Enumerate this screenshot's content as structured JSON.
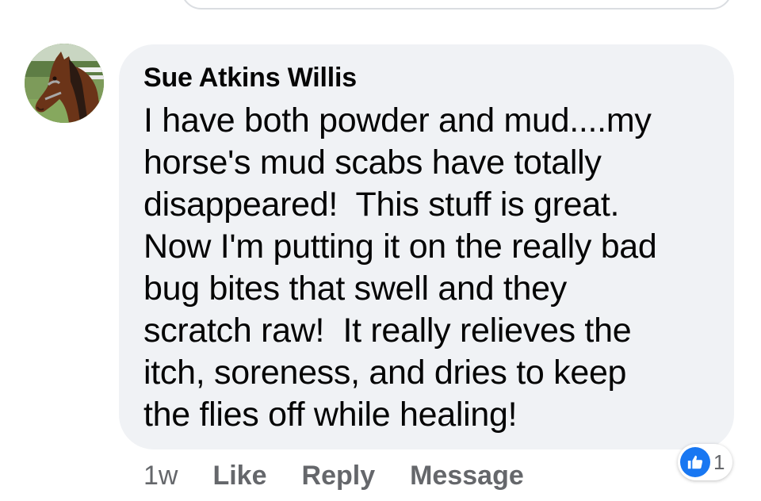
{
  "comment": {
    "author": "Sue Atkins Willis",
    "text_lines": [
      "I have both powder and mud....my",
      "horse's mud scabs have totally",
      "disappeared!  This stuff is great.",
      "Now I'm putting it on the really bad",
      "bug bites that swell and they",
      "scratch raw!  It really relieves the",
      "itch, soreness, and dries to keep",
      "the flies off while healing!"
    ],
    "avatar_icon": "horse-profile-photo"
  },
  "actions": {
    "timestamp": "1w",
    "like_label": "Like",
    "reply_label": "Reply",
    "message_label": "Message"
  },
  "reactions": {
    "icon": "thumbs-up-icon",
    "count": "1",
    "color": "#1877f2"
  }
}
